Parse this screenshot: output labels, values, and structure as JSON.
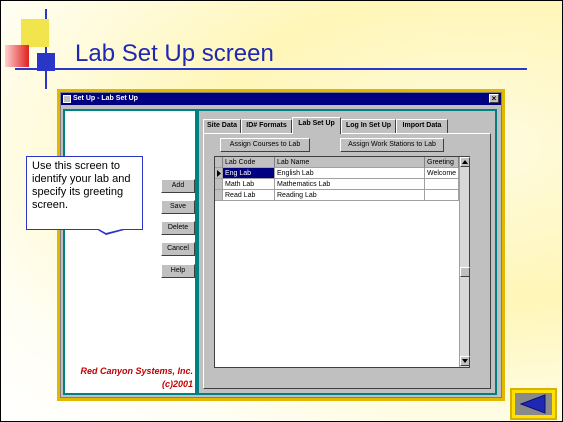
{
  "slide": {
    "title": "Lab Set Up screen",
    "callout": "Use this screen to identify your lab and specify its greeting screen."
  },
  "window": {
    "title": "Set Up - Lab Set Up",
    "close_label": "×",
    "side_buttons": {
      "add": "Add",
      "save": "Save",
      "delete": "Delete",
      "cancel": "Cancel",
      "help": "Help"
    },
    "brand_name": "Red Canyon Systems, Inc.",
    "brand_copyright": "(c)2001"
  },
  "tabs": [
    "Site Data",
    "ID# Formats",
    "Lab Set Up",
    "Log In Set Up",
    "Import Data"
  ],
  "active_tab": "Lab Set Up",
  "actions": {
    "assign_courses": "Assign Courses to Lab",
    "assign_workstations": "Assign Work Stations to Lab"
  },
  "grid": {
    "columns": [
      "Lab Code",
      "Lab Name",
      "Greeting"
    ],
    "rows": [
      [
        "Eng Lab",
        "English Lab",
        "Welcome"
      ],
      [
        "Math Lab",
        "Mathematics Lab",
        ""
      ],
      [
        "Read Lab",
        "Reading Lab",
        ""
      ]
    ]
  },
  "colors": {
    "accent_blue": "#1e28b4",
    "brand_red": "#c00000",
    "window_frame": "#e0b800",
    "pane_border": "#008080"
  },
  "icons": {
    "nav_back": "triangle-left-icon",
    "row_pointer": "triangle-right-icon"
  }
}
